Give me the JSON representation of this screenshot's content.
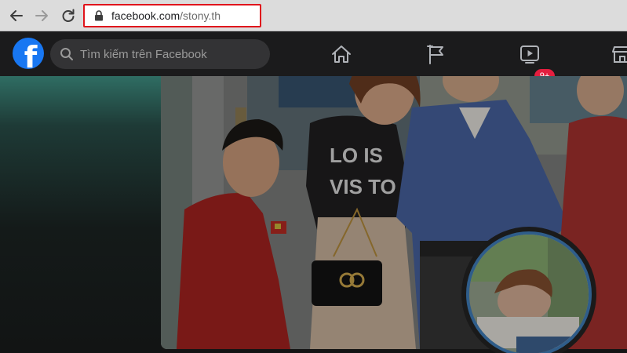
{
  "browser": {
    "url_host": "facebook.com",
    "url_path": "/stony.th",
    "highlight_color": "#e0141c"
  },
  "facebook": {
    "logo_letter": "f",
    "brand_color": "#1877f2",
    "search_placeholder": "Tìm kiếm trên Facebook",
    "nav_icons": [
      "home-icon",
      "flag-icon",
      "watch-icon",
      "marketplace-icon"
    ],
    "watch_badge": "9+",
    "badge_color": "#e41e3f"
  },
  "profile": {
    "cover_photo": "family-cover-photo",
    "profile_picture": "profile-picture"
  }
}
